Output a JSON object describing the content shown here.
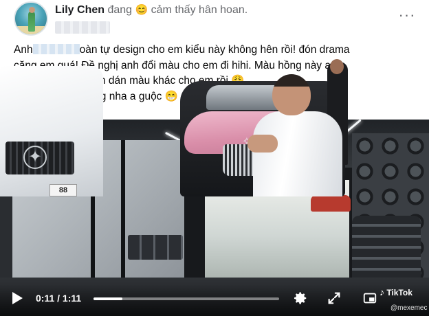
{
  "post": {
    "author": "Lily Chen",
    "feeling_prefix": "đang",
    "feeling_emoji": "😊",
    "feeling_text": "cảm thấy hân hoan.",
    "more_icon": "more-horizontal-icon",
    "more_label": "···"
  },
  "text": {
    "line1_a": "Anh",
    "line1_b": "oàn tự design cho em kiểu này không hên rồi!  đón drama",
    "line2": "căng em quá! Đề nghị anh đổi màu cho em đi hihi. Màu hồng này anh",
    "line3": "dán nhanh quá nên dán màu khác cho em rồi",
    "line3_emoji": "😩",
    "line4": "Đổi màu vàng đồng nha a guộc",
    "line4_emoji": "😁"
  },
  "video": {
    "time": "0:11 / 1:11",
    "progress": 0.155,
    "plate_text": "88",
    "icons": [
      "play-icon",
      "gear-icon",
      "fullscreen-icon",
      "pip-icon",
      "tiktok-logo-icon"
    ],
    "tiktok_label": "TikTok",
    "tiktok_handle": "@mexemec"
  }
}
